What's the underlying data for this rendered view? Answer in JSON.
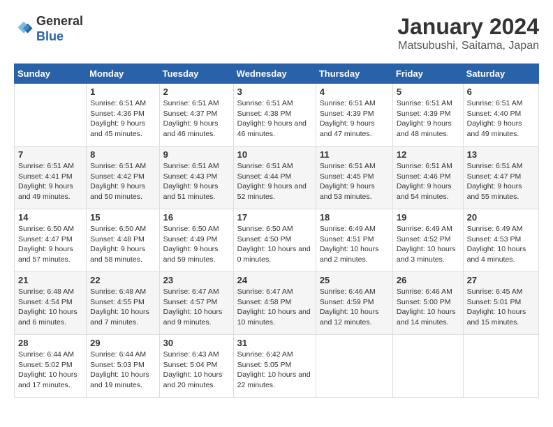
{
  "header": {
    "logo_line1": "General",
    "logo_line2": "Blue",
    "title": "January 2024",
    "subtitle": "Matsubushi, Saitama, Japan"
  },
  "days": [
    "Sunday",
    "Monday",
    "Tuesday",
    "Wednesday",
    "Thursday",
    "Friday",
    "Saturday"
  ],
  "weeks": [
    [
      {
        "date": "",
        "sunrise": "",
        "sunset": "",
        "daylight": ""
      },
      {
        "date": "1",
        "sunrise": "Sunrise: 6:51 AM",
        "sunset": "Sunset: 4:36 PM",
        "daylight": "Daylight: 9 hours and 45 minutes."
      },
      {
        "date": "2",
        "sunrise": "Sunrise: 6:51 AM",
        "sunset": "Sunset: 4:37 PM",
        "daylight": "Daylight: 9 hours and 46 minutes."
      },
      {
        "date": "3",
        "sunrise": "Sunrise: 6:51 AM",
        "sunset": "Sunset: 4:38 PM",
        "daylight": "Daylight: 9 hours and 46 minutes."
      },
      {
        "date": "4",
        "sunrise": "Sunrise: 6:51 AM",
        "sunset": "Sunset: 4:39 PM",
        "daylight": "Daylight: 9 hours and 47 minutes."
      },
      {
        "date": "5",
        "sunrise": "Sunrise: 6:51 AM",
        "sunset": "Sunset: 4:39 PM",
        "daylight": "Daylight: 9 hours and 48 minutes."
      },
      {
        "date": "6",
        "sunrise": "Sunrise: 6:51 AM",
        "sunset": "Sunset: 4:40 PM",
        "daylight": "Daylight: 9 hours and 49 minutes."
      }
    ],
    [
      {
        "date": "7",
        "sunrise": "Sunrise: 6:51 AM",
        "sunset": "Sunset: 4:41 PM",
        "daylight": "Daylight: 9 hours and 49 minutes."
      },
      {
        "date": "8",
        "sunrise": "Sunrise: 6:51 AM",
        "sunset": "Sunset: 4:42 PM",
        "daylight": "Daylight: 9 hours and 50 minutes."
      },
      {
        "date": "9",
        "sunrise": "Sunrise: 6:51 AM",
        "sunset": "Sunset: 4:43 PM",
        "daylight": "Daylight: 9 hours and 51 minutes."
      },
      {
        "date": "10",
        "sunrise": "Sunrise: 6:51 AM",
        "sunset": "Sunset: 4:44 PM",
        "daylight": "Daylight: 9 hours and 52 minutes."
      },
      {
        "date": "11",
        "sunrise": "Sunrise: 6:51 AM",
        "sunset": "Sunset: 4:45 PM",
        "daylight": "Daylight: 9 hours and 53 minutes."
      },
      {
        "date": "12",
        "sunrise": "Sunrise: 6:51 AM",
        "sunset": "Sunset: 4:46 PM",
        "daylight": "Daylight: 9 hours and 54 minutes."
      },
      {
        "date": "13",
        "sunrise": "Sunrise: 6:51 AM",
        "sunset": "Sunset: 4:47 PM",
        "daylight": "Daylight: 9 hours and 55 minutes."
      }
    ],
    [
      {
        "date": "14",
        "sunrise": "Sunrise: 6:50 AM",
        "sunset": "Sunset: 4:47 PM",
        "daylight": "Daylight: 9 hours and 57 minutes."
      },
      {
        "date": "15",
        "sunrise": "Sunrise: 6:50 AM",
        "sunset": "Sunset: 4:48 PM",
        "daylight": "Daylight: 9 hours and 58 minutes."
      },
      {
        "date": "16",
        "sunrise": "Sunrise: 6:50 AM",
        "sunset": "Sunset: 4:49 PM",
        "daylight": "Daylight: 9 hours and 59 minutes."
      },
      {
        "date": "17",
        "sunrise": "Sunrise: 6:50 AM",
        "sunset": "Sunset: 4:50 PM",
        "daylight": "Daylight: 10 hours and 0 minutes."
      },
      {
        "date": "18",
        "sunrise": "Sunrise: 6:49 AM",
        "sunset": "Sunset: 4:51 PM",
        "daylight": "Daylight: 10 hours and 2 minutes."
      },
      {
        "date": "19",
        "sunrise": "Sunrise: 6:49 AM",
        "sunset": "Sunset: 4:52 PM",
        "daylight": "Daylight: 10 hours and 3 minutes."
      },
      {
        "date": "20",
        "sunrise": "Sunrise: 6:49 AM",
        "sunset": "Sunset: 4:53 PM",
        "daylight": "Daylight: 10 hours and 4 minutes."
      }
    ],
    [
      {
        "date": "21",
        "sunrise": "Sunrise: 6:48 AM",
        "sunset": "Sunset: 4:54 PM",
        "daylight": "Daylight: 10 hours and 6 minutes."
      },
      {
        "date": "22",
        "sunrise": "Sunrise: 6:48 AM",
        "sunset": "Sunset: 4:55 PM",
        "daylight": "Daylight: 10 hours and 7 minutes."
      },
      {
        "date": "23",
        "sunrise": "Sunrise: 6:47 AM",
        "sunset": "Sunset: 4:57 PM",
        "daylight": "Daylight: 10 hours and 9 minutes."
      },
      {
        "date": "24",
        "sunrise": "Sunrise: 6:47 AM",
        "sunset": "Sunset: 4:58 PM",
        "daylight": "Daylight: 10 hours and 10 minutes."
      },
      {
        "date": "25",
        "sunrise": "Sunrise: 6:46 AM",
        "sunset": "Sunset: 4:59 PM",
        "daylight": "Daylight: 10 hours and 12 minutes."
      },
      {
        "date": "26",
        "sunrise": "Sunrise: 6:46 AM",
        "sunset": "Sunset: 5:00 PM",
        "daylight": "Daylight: 10 hours and 14 minutes."
      },
      {
        "date": "27",
        "sunrise": "Sunrise: 6:45 AM",
        "sunset": "Sunset: 5:01 PM",
        "daylight": "Daylight: 10 hours and 15 minutes."
      }
    ],
    [
      {
        "date": "28",
        "sunrise": "Sunrise: 6:44 AM",
        "sunset": "Sunset: 5:02 PM",
        "daylight": "Daylight: 10 hours and 17 minutes."
      },
      {
        "date": "29",
        "sunrise": "Sunrise: 6:44 AM",
        "sunset": "Sunset: 5:03 PM",
        "daylight": "Daylight: 10 hours and 19 minutes."
      },
      {
        "date": "30",
        "sunrise": "Sunrise: 6:43 AM",
        "sunset": "Sunset: 5:04 PM",
        "daylight": "Daylight: 10 hours and 20 minutes."
      },
      {
        "date": "31",
        "sunrise": "Sunrise: 6:42 AM",
        "sunset": "Sunset: 5:05 PM",
        "daylight": "Daylight: 10 hours and 22 minutes."
      },
      {
        "date": "",
        "sunrise": "",
        "sunset": "",
        "daylight": ""
      },
      {
        "date": "",
        "sunrise": "",
        "sunset": "",
        "daylight": ""
      },
      {
        "date": "",
        "sunrise": "",
        "sunset": "",
        "daylight": ""
      }
    ]
  ]
}
